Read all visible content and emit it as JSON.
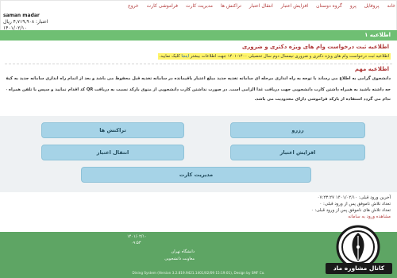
{
  "nav": {
    "items": [
      "خانه",
      "پروفایل",
      "پرو",
      "گروه دوستان",
      "افزایش اعتبار",
      "انتقال اعتبار",
      "تراکنش ها",
      "مدیریت کارت",
      "فراموشی کارت",
      "خروج"
    ]
  },
  "user": {
    "name": "saman madar",
    "credit": "اعتبار: ۴,۷۱۹,۹۰۸ ریال",
    "date": "۱۴۰۱/۰۲/۱۰"
  },
  "section": {
    "title": "اطلاعیه ۱"
  },
  "notice": {
    "title": "اطلاعیه ثبت درخواست وام های ویژه دکتری و ضروری",
    "highlight_main": "اطلاعیه ثبت درخواست وام های ویژه دکتری و ضروری نیمسال دوم سال تحصیلی ۱۴۰۰-۱۴۰۱ جهت اطلاعات بیشتر",
    "highlight_link": "اینجا",
    "highlight_tail": "کلیک نمایید.",
    "important_title": "اطلاعیه مهم",
    "line1": "دانشجوی گرامی به اطلاع می رساند با توجه به راه اندازی مرحله ای سامانه تغذیه جدید مبلغ اعتبار باقیمانده در سامانه تغذیه قبل محفوظ می باشد و بعد از اتمام راه اندازی سامانه جدید به کیف پول شما انتقال داده خواهد شد.",
    "line2": "حه داشته باشید به همراه داشتن کارت دانشجویی جهت دریافت غذا الزامی است. در صورت نداشتن کارت دانشجویی از منوی بارکد نسبت به دریافت QR کد اقدام نمایید و سپس با تلفن همراه خود به محل توزیع غذا مراجعه نمایید.",
    "line3": "ندام می گردد استفاده از بارکد فراموشی دارای محدودیت می باشد."
  },
  "buttons": {
    "reserve": "رزرو",
    "transactions": "تراکنش ها",
    "add_credit": "افزایش اعتبار",
    "transfer_credit": "انتقال اعتبار",
    "manage_card": "مدیریت کارت"
  },
  "info": {
    "last_login": "آخرین ورود قبلی: ۱۴۰۱/۰۲/۱۰ ۰۷:۲۳:۲۷",
    "failed_attempts": "تعداد تلاش ناموفق پس از ورود قبلی: ۰",
    "failed_attempts2": "تعداد تلاش های ناموفق پس از ورود قبلی: ۰",
    "more_link": "مشاهده ورود به سامانه"
  },
  "footer": {
    "date": "۱۴۰۱/۰۲/۱۰",
    "time": "۰۹:۵۳",
    "university": "دانشگاه تهران",
    "deputy": "معاونت دانشجویی",
    "copyright": "Dining System (Version 3.2.819.9421.1401/02/09 15:19:01), Design by SMF Co."
  },
  "watermark": {
    "text": "کانال مشاوره ماد"
  },
  "colors": {
    "nav_link": "#b33a3a",
    "green": "#6fbf73",
    "footer_green": "#5ea564",
    "button": "#a6d3e7",
    "highlight": "#fff46a"
  }
}
